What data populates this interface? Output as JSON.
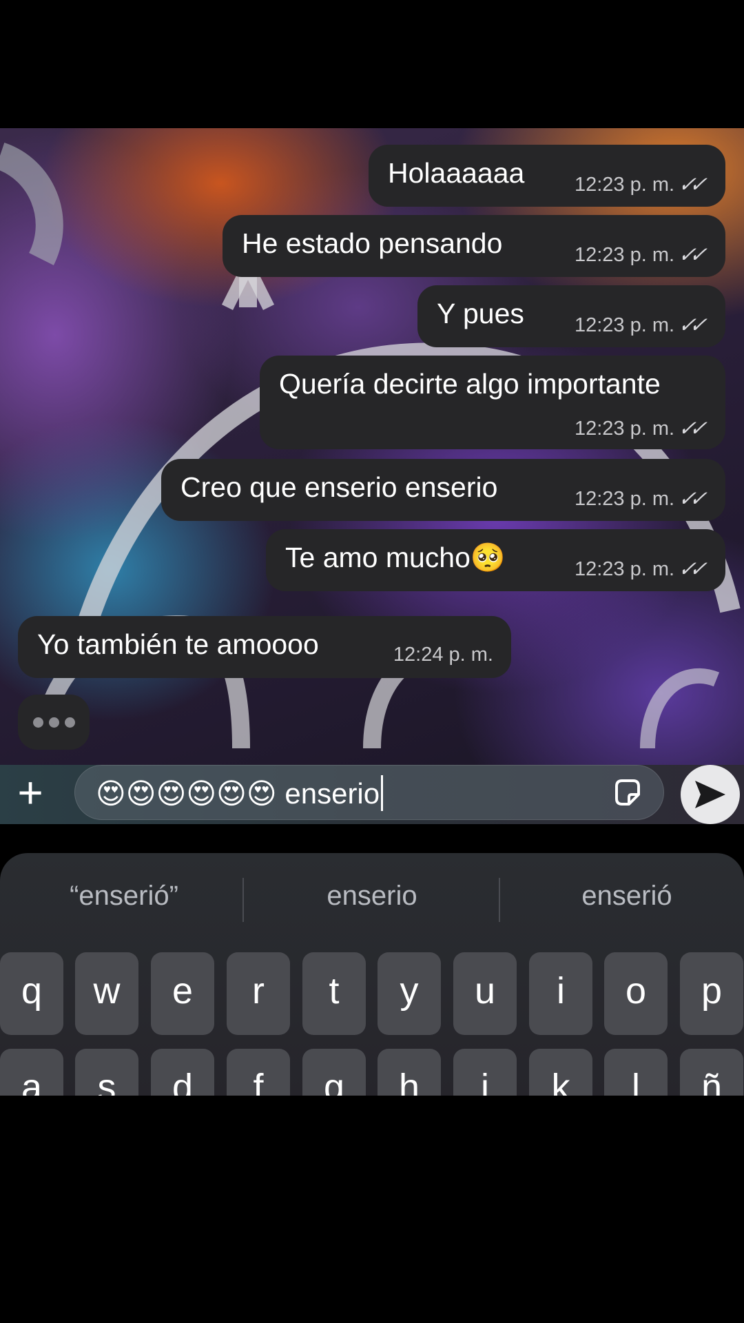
{
  "messages": [
    {
      "text": "Holaaaaaa",
      "time": "12:23 p. m.",
      "ticks": "✓✓"
    },
    {
      "text": "He estado pensando",
      "time": "12:23 p. m.",
      "ticks": "✓✓"
    },
    {
      "text": "Y pues",
      "time": "12:23 p. m.",
      "ticks": "✓✓"
    },
    {
      "text": "Quería decirte algo importante",
      "time": "12:23 p. m.",
      "ticks": "✓✓"
    },
    {
      "text": "Creo que enserio enserio",
      "time": "12:23 p. m.",
      "ticks": "✓✓"
    },
    {
      "text": "Te amo mucho🥺",
      "time": "12:23 p. m.",
      "ticks": "✓✓"
    },
    {
      "text": "Yo también te amoooo",
      "time": "12:24 p. m."
    }
  ],
  "composer": {
    "plus_label": "+",
    "input_value": "😍😍😍😍😍😍 enserio",
    "send_icon": "send-arrow-icon",
    "sticker_icon": "sticker-icon"
  },
  "keyboard": {
    "suggestions": [
      "“enserió”",
      "enserio",
      "enserió"
    ],
    "row1": [
      "q",
      "w",
      "e",
      "r",
      "t",
      "y",
      "u",
      "i",
      "o",
      "p"
    ],
    "row2": [
      "a",
      "s",
      "d",
      "f",
      "g",
      "h",
      "j",
      "k",
      "l",
      "ñ"
    ]
  }
}
